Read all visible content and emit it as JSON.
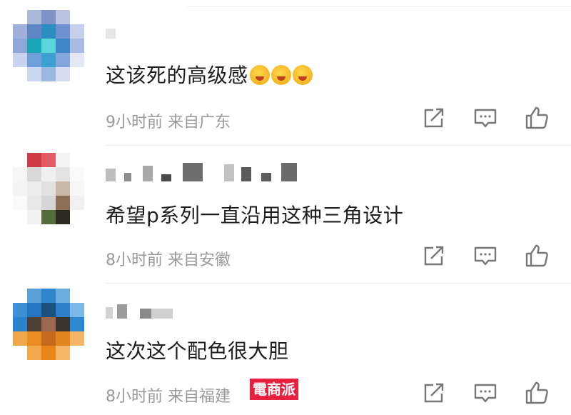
{
  "comments": [
    {
      "text": "这该死的高级感",
      "emojis": [
        "laughing-crying-emoji",
        "grinning-emoji",
        "grinning-emoji"
      ],
      "time": "9小时前",
      "location": "来自广东"
    },
    {
      "text": "希望p系列一直沿用这种三角设计",
      "emojis": [],
      "time": "8小时前",
      "location": "来自安徽"
    },
    {
      "text": "这次这个配色很大胆",
      "emojis": [],
      "time": "8小时前",
      "location": "来自福建"
    }
  ],
  "icons": {
    "share": "share-icon",
    "reply": "comment-icon",
    "like": "thumbs-up-icon"
  },
  "watermark": "電商派",
  "colors": {
    "meta": "#9a9a9a",
    "watermark_bg": "#e8203f"
  }
}
